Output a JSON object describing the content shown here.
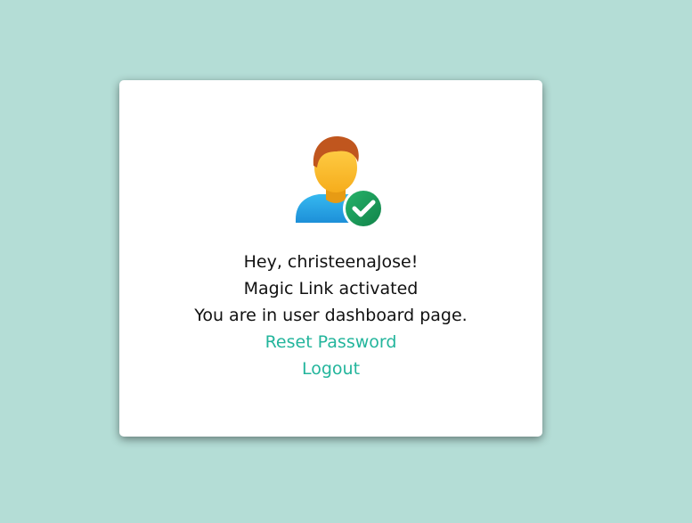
{
  "card": {
    "icon": "user-verified-icon",
    "greeting": "Hey, christeenaJose!",
    "status": "Magic Link activated",
    "location": "You are in user dashboard page.",
    "links": {
      "reset_password": "Reset Password",
      "logout": "Logout"
    }
  },
  "colors": {
    "background": "#b4ddd6",
    "card": "#ffffff",
    "link": "#23b59c",
    "check_badge": "#1f9a55"
  }
}
